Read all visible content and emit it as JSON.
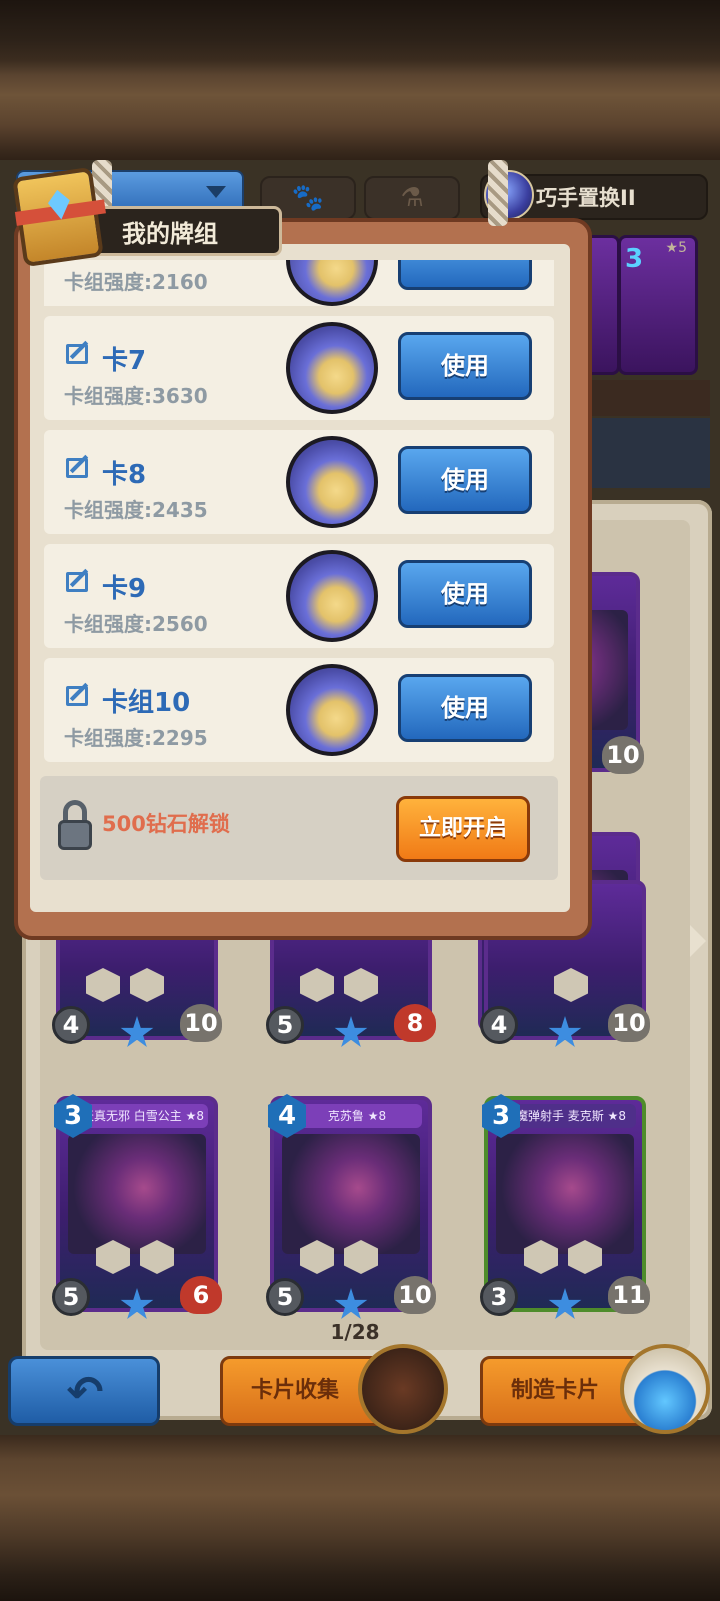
{
  "header": {
    "swap_label": "巧手置换II",
    "side_card_cost": "3",
    "side_card_star": "★5"
  },
  "modal": {
    "title": "我的牌组",
    "partial_power": "卡组强度:2160",
    "decks": [
      {
        "name": "卡7",
        "power": "卡组强度:3630",
        "button": "使用"
      },
      {
        "name": "卡8",
        "power": "卡组强度:2435",
        "button": "使用"
      },
      {
        "name": "卡9",
        "power": "卡组强度:2560",
        "button": "使用"
      },
      {
        "name": "卡组10",
        "power": "卡组强度:2295",
        "button": "使用"
      }
    ],
    "lock_text": "500钻石解锁",
    "open_button": "立即开启"
  },
  "cards_row2": [
    {
      "atk": "4",
      "hp": "10"
    },
    {
      "atk": "5",
      "hp": "8"
    },
    {
      "atk": "4",
      "hp": "10"
    }
  ],
  "cards_row3": [
    {
      "title": "天真无邪 白雪公主 ★8",
      "cost": "3",
      "atk": "5",
      "hp": "6"
    },
    {
      "title": "克苏鲁 ★8",
      "cost": "4",
      "atk": "5",
      "hp": "10"
    },
    {
      "title": "魔弹射手 麦克斯 ★8",
      "cost": "3",
      "atk": "3",
      "hp": "11"
    }
  ],
  "pagination": "1/28",
  "bottom": {
    "collection_label": "卡片收集",
    "craft_label": "制造卡片"
  },
  "colors": {
    "accent_blue": "#2d6ab6",
    "accent_orange": "#f07a16",
    "lock_text": "#e06d4d"
  }
}
